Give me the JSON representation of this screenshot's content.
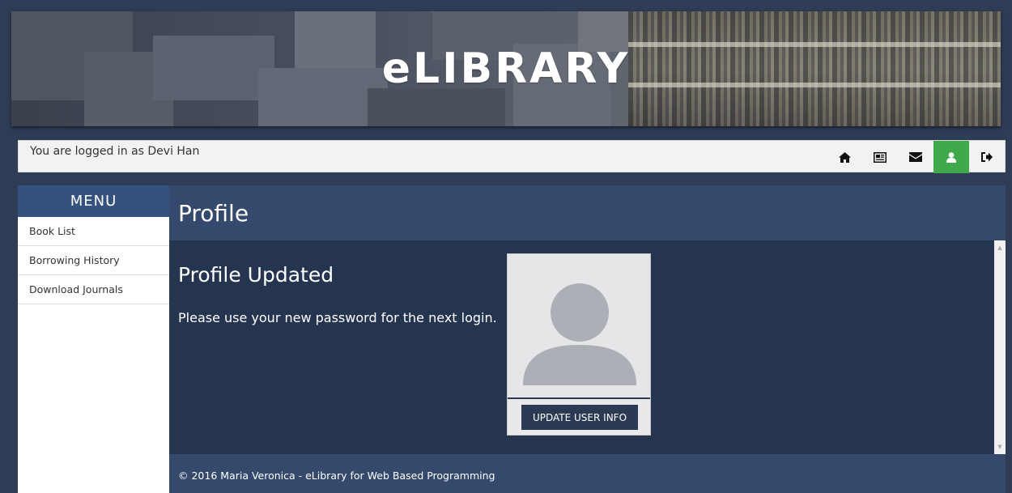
{
  "app": {
    "title": "eLIBRARY"
  },
  "login": {
    "text": "You are logged in as Devi Han"
  },
  "nav": {
    "icons": [
      {
        "name": "home-icon",
        "active": false
      },
      {
        "name": "catalog-icon",
        "active": false
      },
      {
        "name": "mail-icon",
        "active": false
      },
      {
        "name": "user-icon",
        "active": true
      },
      {
        "name": "logout-icon",
        "active": false
      }
    ],
    "active_color": "#3fa84a"
  },
  "sidebar": {
    "heading": "MENU",
    "items": [
      {
        "label": "Book List"
      },
      {
        "label": "Borrowing History"
      },
      {
        "label": "Download Journals"
      }
    ]
  },
  "main": {
    "title": "Profile",
    "heading": "Profile Updated",
    "message": "Please use your new password for the next login.",
    "profile_card": {
      "button_label": "UPDATE USER INFO"
    }
  },
  "footer": {
    "text": "© 2016 Maria Veronica - eLibrary for Web Based Programming"
  },
  "colors": {
    "page_bg": "#2e3d55",
    "header_bg": "#34496c",
    "content_bg": "#253550",
    "menu_head": "#35517e"
  }
}
